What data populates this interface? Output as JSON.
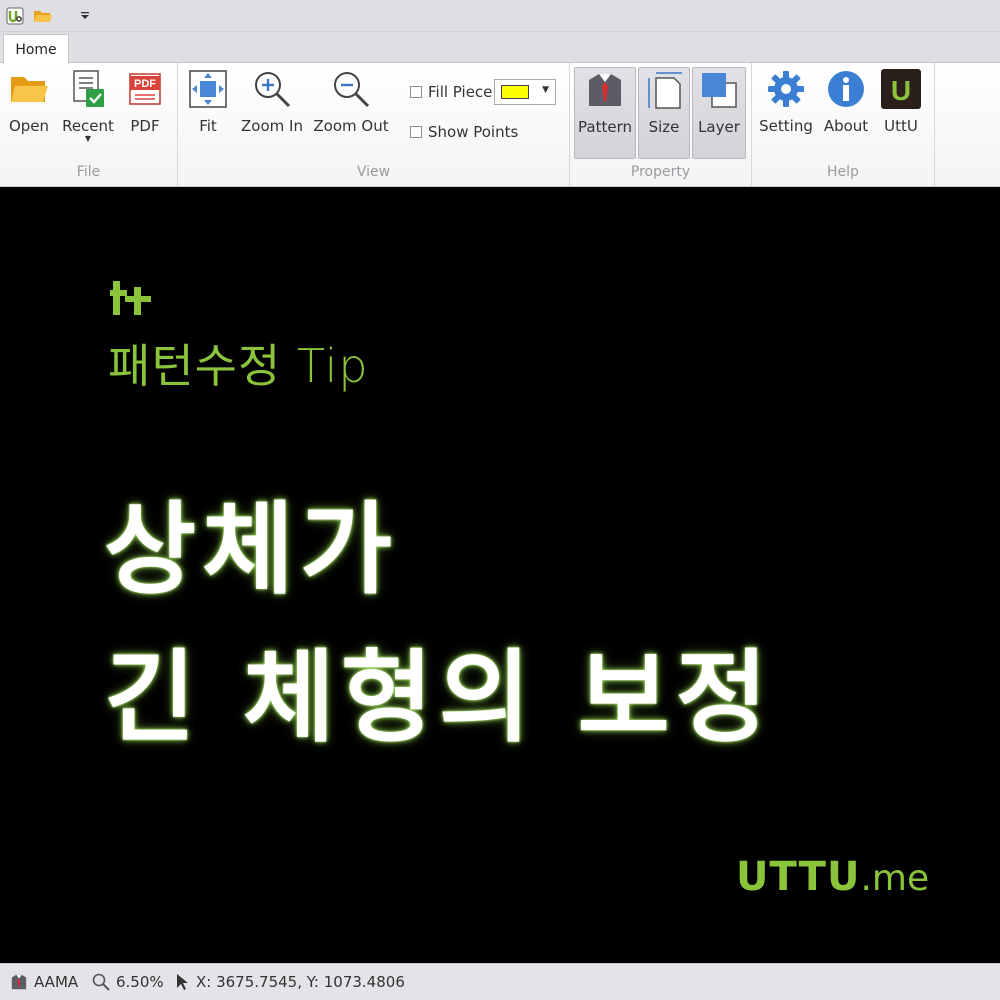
{
  "titlebar": {
    "quick_access": [
      "app-logo-icon",
      "open-folder-icon",
      "customize-dropdown-icon"
    ]
  },
  "tabs": [
    {
      "label": "Home",
      "active": true
    }
  ],
  "ribbon": {
    "file": {
      "label": "File",
      "open": "Open",
      "recent": "Recent",
      "pdf": "PDF",
      "pdf_icon_text": "PDF"
    },
    "view": {
      "label": "View",
      "fit": "Fit",
      "zoom_in": "Zoom In",
      "zoom_out": "Zoom Out",
      "fill_piece": "Fill Piece",
      "fill_piece_checked": false,
      "fill_color": "#ffff00",
      "show_points": "Show Points",
      "show_points_checked": false
    },
    "property": {
      "label": "Property",
      "pattern": "Pattern",
      "size": "Size",
      "layer": "Layer"
    },
    "help": {
      "label": "Help",
      "setting": "Setting",
      "about": "About",
      "uttu": "UttU",
      "uttu_icon_text": "U"
    }
  },
  "canvas": {
    "tip_title": "패턴수정 Tip",
    "headline_line1": "상체가",
    "headline_line2": "긴 체형의 보정",
    "logo_brand": "UTTU",
    "logo_domain": ".me",
    "accent_color": "#8bc33a"
  },
  "status": {
    "pattern_name": "AAMA",
    "zoom": "6.50%",
    "coords": "X: 3675.7545, Y: 1073.4806"
  }
}
